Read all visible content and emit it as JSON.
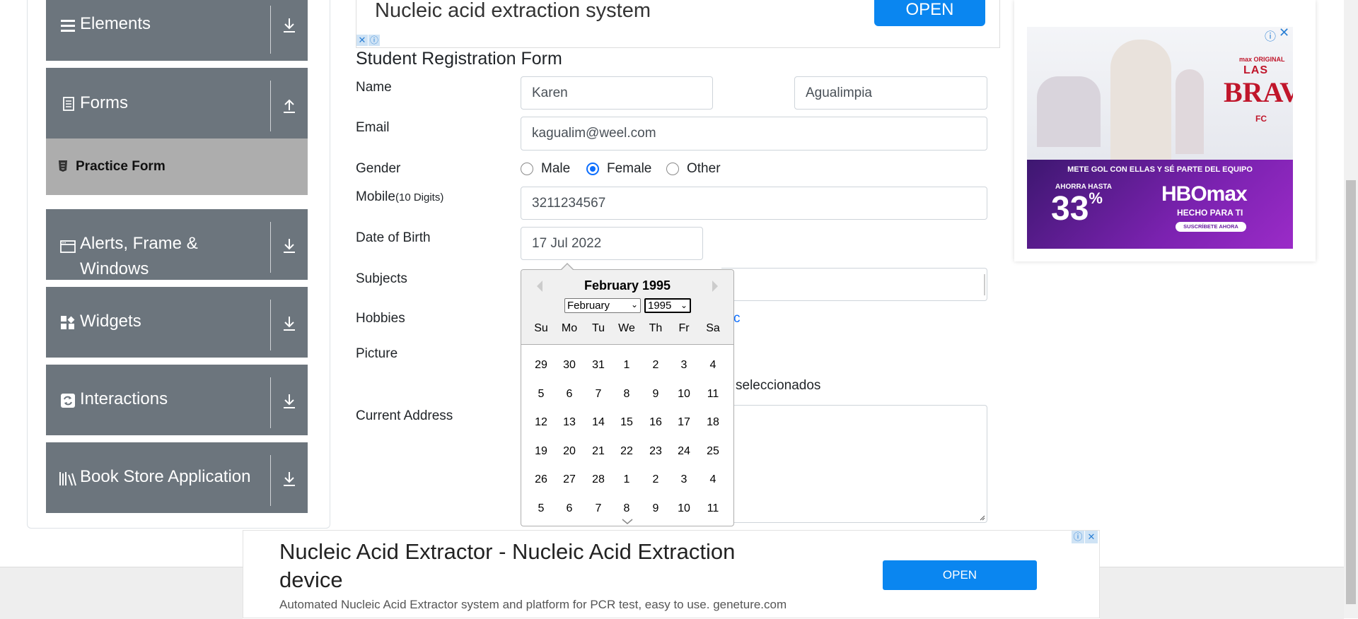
{
  "sidebar": {
    "groups": [
      {
        "label": "Elements"
      },
      {
        "label": "Forms"
      },
      {
        "label_line1": "Alerts, Frame &",
        "label_line2": "Windows"
      },
      {
        "label": "Widgets"
      },
      {
        "label": "Interactions"
      },
      {
        "label": "Book Store Application"
      }
    ],
    "active_item": "Practice Form"
  },
  "form": {
    "title": "Student Registration Form",
    "name_label": "Name",
    "first_name": "Karen",
    "last_name": "Agualimpia",
    "email_label": "Email",
    "email": "kagualim@weel.com",
    "gender_label": "Gender",
    "gender_options": [
      "Male",
      "Female",
      "Other"
    ],
    "gender_selected": "Female",
    "mobile_label": "Mobile",
    "mobile_hint": "(10 Digits)",
    "mobile": "3211234567",
    "dob_label": "Date of Birth",
    "dob": "17 Jul 2022",
    "subjects_label": "Subjects",
    "hobbies_label": "Hobbies",
    "hobbies_partial": "c",
    "picture_label": "Picture",
    "picture_status_partial": "seleccionados",
    "address_label": "Current Address"
  },
  "datepicker": {
    "title": "February 1995",
    "month_select": "February",
    "year_select": "1995",
    "day_names": [
      "Su",
      "Mo",
      "Tu",
      "We",
      "Th",
      "Fr",
      "Sa"
    ],
    "weeks": [
      [
        "29",
        "30",
        "31",
        "1",
        "2",
        "3",
        "4"
      ],
      [
        "5",
        "6",
        "7",
        "8",
        "9",
        "10",
        "11"
      ],
      [
        "12",
        "13",
        "14",
        "15",
        "16",
        "17",
        "18"
      ],
      [
        "19",
        "20",
        "21",
        "22",
        "23",
        "24",
        "25"
      ],
      [
        "26",
        "27",
        "28",
        "1",
        "2",
        "3",
        "4"
      ],
      [
        "5",
        "6",
        "7",
        "8",
        "9",
        "10",
        "11"
      ]
    ]
  },
  "ads": {
    "top_title": "Nucleic acid extraction system",
    "top_button": "OPEN",
    "right_brand_small": "max ORIGINAL",
    "right_title_1": "LAS",
    "right_title_2": "BRAVAS",
    "right_title_3": "FC",
    "right_tagline": "METE GOL CON ELLAS Y SÉ PARTE DEL EQUIPO",
    "right_until": "AHORRA HASTA",
    "right_percent": "33",
    "right_percent_sign": "%",
    "right_logo": "HBOmax",
    "right_sub": "HECHO PARA TI",
    "right_cta": "SUSCRÍBETE AHORA",
    "bottom_title_1": "Nucleic Acid Extractor - Nucleic Acid Extraction",
    "bottom_title_2": "device",
    "bottom_desc": "Automated Nucleic Acid Extractor system and platform for PCR test, easy to use. geneture.com",
    "bottom_button": "OPEN"
  },
  "colors": {
    "sidebar_group": "#6c757d",
    "active_item": "#adadad",
    "accent": "#0d6efd",
    "ad_button": "#0a86f0"
  }
}
